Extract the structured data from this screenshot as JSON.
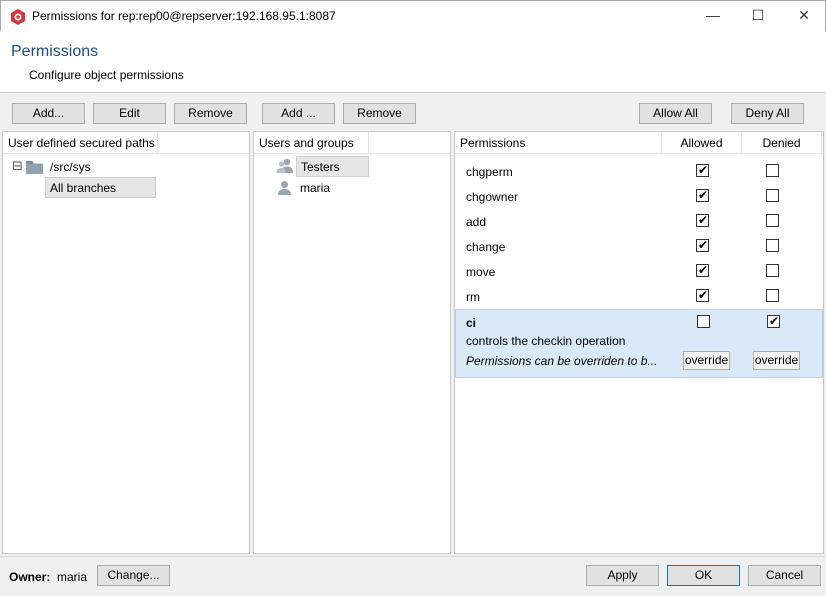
{
  "window": {
    "title": "Permissions for rep:rep00@repserver:192.168.95.1:8087",
    "minimize_glyph": "—",
    "maximize_glyph": "☐",
    "close_glyph": "✕"
  },
  "header": {
    "title": "Permissions",
    "subtitle": "Configure object permissions"
  },
  "toolbar": {
    "add_path": "Add...",
    "edit_path": "Edit",
    "remove_path": "Remove",
    "add_user": "Add ...",
    "remove_user": "Remove",
    "allow_all": "Allow All",
    "deny_all": "Deny All"
  },
  "paths_panel": {
    "header": "User defined secured paths",
    "expander": "⊟",
    "path": "/src/sys",
    "branch": "All branches"
  },
  "users_panel": {
    "header": "Users and groups",
    "items": [
      "Testers",
      "maria"
    ]
  },
  "permissions_panel": {
    "col_permissions": "Permissions",
    "col_allowed": "Allowed",
    "col_denied": "Denied",
    "rows": [
      {
        "name": "chgperm",
        "allowed": true,
        "denied": false
      },
      {
        "name": "chgowner",
        "allowed": true,
        "denied": false
      },
      {
        "name": "add",
        "allowed": true,
        "denied": false
      },
      {
        "name": "change",
        "allowed": true,
        "denied": false
      },
      {
        "name": "move",
        "allowed": true,
        "denied": false
      },
      {
        "name": "rm",
        "allowed": true,
        "denied": false
      }
    ],
    "selected": {
      "name": "ci",
      "description": "controls the checkin operation",
      "note": "Permissions can be overriden to b...",
      "allowed": false,
      "denied": true,
      "override_label": "override"
    },
    "check_glyph": "✔"
  },
  "footer": {
    "owner_label": "Owner:",
    "owner_value": "maria",
    "change_button": "Change...",
    "apply_button": "Apply",
    "ok_button": "OK",
    "cancel_button": "Cancel"
  },
  "colors": {
    "accent": "#1b4f8e",
    "selection": "#d9e9f7",
    "brand": "#d9343a"
  }
}
